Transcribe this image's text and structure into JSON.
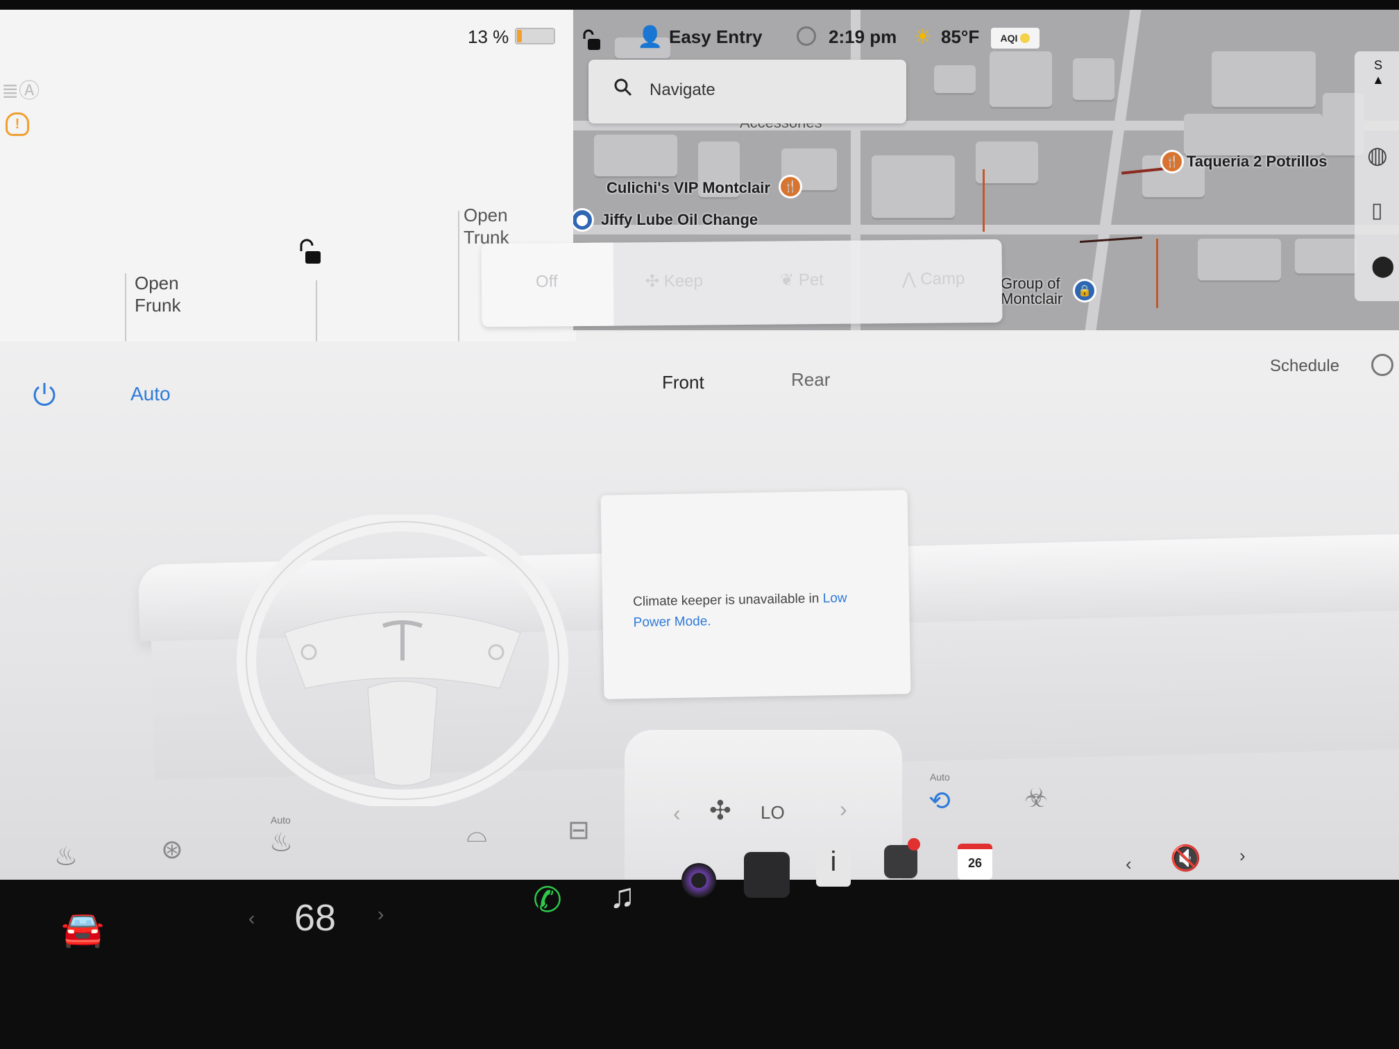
{
  "status_bar": {
    "battery_percent": "13 %",
    "battery_level": 0.13,
    "profile": "Easy Entry",
    "time": "2:19 pm",
    "temperature": "85°F",
    "aqi_label": "AQI"
  },
  "car_panel": {
    "open_trunk": "Open\nTrunk",
    "open_frunk": "Open\nFrunk"
  },
  "map": {
    "search_placeholder": "Navigate",
    "compass": "S",
    "pois": [
      {
        "label": "Culichi's VIP Montclair",
        "kind": "food"
      },
      {
        "label": "Jiffy Lube Oil Change",
        "kind": "service"
      },
      {
        "label": "Taqueria 2 Potrillos",
        "kind": "food"
      },
      {
        "label": "Group of\nMontclair",
        "kind": "service"
      },
      {
        "label": "Accessories",
        "kind": "service"
      }
    ]
  },
  "climate_keeper": {
    "options": [
      "Off",
      "Keep",
      "Pet",
      "Camp"
    ],
    "selected": "Off",
    "message_prefix": "Climate keeper is unavailable in ",
    "message_link": "Low Power Mode."
  },
  "climate": {
    "mode": "Auto",
    "tabs": [
      "Front",
      "Rear"
    ],
    "active_tab": "Front",
    "schedule": "Schedule",
    "fan_speed": "LO",
    "recirc_auto_label": "Auto",
    "defrost_auto_label": "Auto"
  },
  "dock": {
    "cabin_temp": "68",
    "calendar_day": "26"
  },
  "colors": {
    "accent": "#2e7ad8",
    "phone": "#2fc94a",
    "alert": "#f0a030"
  }
}
